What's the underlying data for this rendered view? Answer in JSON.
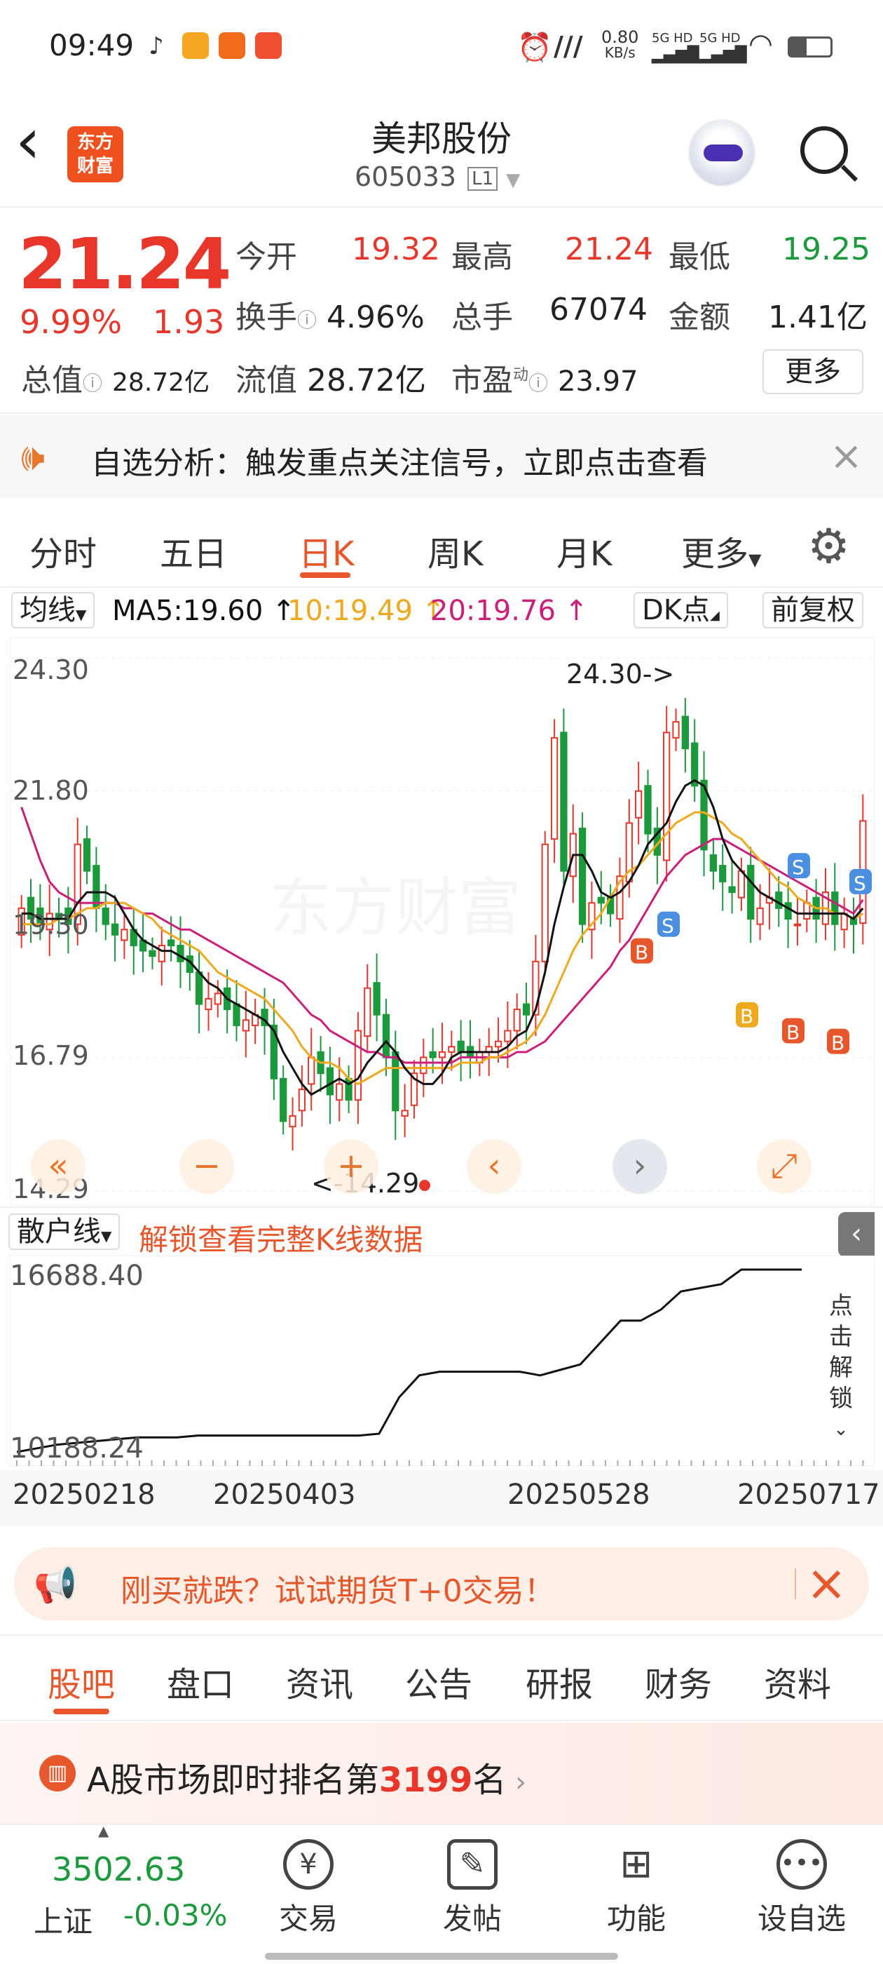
{
  "status_bar": {
    "time": "09:49",
    "net_speed": "0.80",
    "net_unit": "KB/s",
    "sig1": "5G HD",
    "sig2": "5G HD"
  },
  "header": {
    "back": "‹",
    "logo_line1": "东方",
    "logo_line2": "财富",
    "stock_name": "美邦股份",
    "stock_code": "605033",
    "level": "L1"
  },
  "quote": {
    "price": "21.24",
    "change_pct": "9.99%",
    "change": "1.93",
    "fields": [
      {
        "label": "今开",
        "value": "19.32"
      },
      {
        "label": "最高",
        "value": "21.24"
      },
      {
        "label": "最低",
        "value": "19.25"
      },
      {
        "label": "换手",
        "value": "4.96%"
      },
      {
        "label": "总手",
        "value": "67074"
      },
      {
        "label": "金额",
        "value": "1.41亿"
      },
      {
        "label": "总值",
        "value": "28.72亿"
      },
      {
        "label": "流值",
        "value": "28.72亿"
      },
      {
        "label": "市盈",
        "value": "23.97"
      }
    ],
    "pe_sup": "动",
    "more_button": "更多"
  },
  "alert_banner": {
    "text": "自选分析：触发重点关注信号，立即点击查看"
  },
  "chart_tabs": [
    "分时",
    "五日",
    "日K",
    "周K",
    "月K",
    "更多"
  ],
  "active_tab": "日K",
  "ma_bar": {
    "selector": "均线",
    "ma5": "MA5:19.60 ↑",
    "ma10": "10:19.49 ↑",
    "ma20": "20:19.76 ↑",
    "dk": "DK点",
    "fq": "前复权"
  },
  "colors": {
    "ma5": "#111111",
    "ma10": "#f0a81c",
    "ma20": "#cc1f7a",
    "up": "#e8362b",
    "down": "#1a9a3a",
    "accent": "#e8572b"
  },
  "chart_data": {
    "type": "candlestick",
    "y_ticks": [
      "24.30",
      "21.80",
      "16.79",
      "14.29"
    ],
    "ylim": [
      14.29,
      24.3
    ],
    "high_label": "24.30->",
    "low_label": "<-14.29",
    "mid_tick": "19.30",
    "x_ticks": [
      "20250218",
      "20250403",
      "20250528",
      "20250717"
    ],
    "close": [
      19.6,
      19.4,
      19.3,
      19.5,
      19.4,
      19.3,
      20.8,
      20.3,
      19.6,
      19.3,
      19.1,
      19.2,
      18.9,
      18.8,
      18.7,
      18.9,
      18.9,
      18.6,
      18.4,
      17.8,
      17.9,
      18.0,
      17.7,
      17.4,
      17.5,
      17.6,
      17.4,
      16.4,
      15.6,
      15.7,
      16.2,
      16.8,
      16.5,
      16.1,
      16.3,
      16.0,
      17.3,
      18.1,
      17.6,
      16.8,
      15.8,
      15.8,
      16.5,
      16.8,
      16.8,
      16.9,
      17.0,
      16.9,
      16.8,
      16.9,
      17.0,
      17.1,
      17.3,
      17.7,
      17.6,
      18.6,
      20.8,
      22.8,
      20.3,
      21.0,
      19.3,
      19.7,
      19.7,
      19.5,
      20.2,
      21.2,
      21.8,
      21.0,
      20.6,
      22.9,
      23.1,
      22.6,
      21.9,
      20.7,
      20.3,
      20.1,
      19.9,
      20.3,
      19.4,
      19.6,
      19.8,
      19.6,
      19.4,
      19.3,
      19.7,
      19.4,
      19.9,
      19.3,
      19.5,
      19.3,
      21.24
    ],
    "open": [
      19.1,
      19.8,
      19.6,
      19.2,
      19.5,
      19.6,
      19.3,
      20.9,
      20.4,
      19.6,
      19.3,
      19.0,
      19.2,
      19.0,
      18.8,
      18.6,
      19.0,
      18.9,
      18.7,
      18.4,
      17.7,
      17.8,
      18.1,
      17.8,
      17.3,
      17.4,
      17.7,
      17.4,
      16.4,
      15.5,
      15.8,
      16.3,
      16.9,
      16.6,
      16.0,
      16.4,
      16.0,
      17.2,
      18.2,
      17.6,
      16.9,
      15.7,
      15.9,
      16.5,
      16.9,
      16.8,
      16.9,
      17.1,
      17.0,
      16.7,
      16.9,
      17.0,
      17.1,
      17.3,
      17.8,
      17.6,
      18.6,
      20.9,
      22.9,
      20.2,
      21.1,
      19.2,
      19.8,
      19.8,
      19.4,
      20.1,
      21.3,
      21.9,
      21.1,
      20.5,
      22.8,
      23.2,
      22.7,
      22.0,
      20.6,
      20.4,
      20.0,
      19.8,
      20.4,
      19.3,
      19.7,
      19.9,
      19.7,
      19.3,
      19.4,
      19.8,
      19.3,
      19.9,
      19.2,
      19.4,
      19.32
    ],
    "ma5": [
      19.5,
      19.5,
      19.4,
      19.4,
      19.4,
      19.4,
      19.7,
      19.9,
      19.9,
      19.9,
      19.8,
      19.5,
      19.2,
      19.0,
      18.9,
      18.8,
      18.8,
      18.7,
      18.6,
      18.4,
      18.2,
      18.1,
      17.9,
      17.8,
      17.7,
      17.6,
      17.5,
      17.3,
      16.9,
      16.6,
      16.3,
      16.1,
      16.2,
      16.3,
      16.4,
      16.3,
      16.4,
      16.7,
      16.9,
      17.1,
      16.9,
      16.6,
      16.4,
      16.3,
      16.3,
      16.5,
      16.8,
      16.9,
      16.9,
      16.9,
      16.9,
      16.9,
      17.0,
      17.2,
      17.3,
      17.7,
      18.4,
      19.3,
      20.0,
      20.6,
      20.6,
      20.3,
      19.9,
      19.8,
      19.9,
      20.1,
      20.4,
      20.8,
      21.0,
      21.2,
      21.6,
      21.9,
      22.0,
      21.9,
      21.5,
      20.9,
      20.5,
      20.3,
      20.1,
      19.9,
      19.8,
      19.7,
      19.6,
      19.5,
      19.5,
      19.5,
      19.5,
      19.5,
      19.5,
      19.4,
      19.6
    ],
    "ma10": [
      19.3,
      19.3,
      19.3,
      19.3,
      19.4,
      19.4,
      19.5,
      19.6,
      19.6,
      19.7,
      19.7,
      19.7,
      19.6,
      19.5,
      19.4,
      19.2,
      19.1,
      19.0,
      18.9,
      18.8,
      18.6,
      18.4,
      18.3,
      18.2,
      18.1,
      18.0,
      17.9,
      17.7,
      17.5,
      17.3,
      17.0,
      16.8,
      16.7,
      16.7,
      16.6,
      16.4,
      16.3,
      16.4,
      16.5,
      16.6,
      16.6,
      16.6,
      16.6,
      16.6,
      16.6,
      16.6,
      16.6,
      16.7,
      16.7,
      16.7,
      16.8,
      16.8,
      16.9,
      17.0,
      17.1,
      17.3,
      17.6,
      18.0,
      18.4,
      18.8,
      19.1,
      19.3,
      19.5,
      19.8,
      20.1,
      20.3,
      20.4,
      20.6,
      20.8,
      21.0,
      21.2,
      21.3,
      21.4,
      21.4,
      21.3,
      21.2,
      21.0,
      20.9,
      20.7,
      20.5,
      20.3,
      20.1,
      20.0,
      19.8,
      19.7,
      19.6,
      19.6,
      19.5,
      19.5,
      19.4,
      19.5
    ],
    "ma20": [
      21.5,
      21.0,
      20.5,
      20.1,
      19.9,
      19.8,
      19.7,
      19.7,
      19.7,
      19.7,
      19.7,
      19.6,
      19.6,
      19.5,
      19.5,
      19.4,
      19.3,
      19.2,
      19.2,
      19.1,
      19.0,
      18.9,
      18.8,
      18.7,
      18.6,
      18.5,
      18.4,
      18.3,
      18.2,
      18.0,
      17.8,
      17.6,
      17.5,
      17.3,
      17.2,
      17.1,
      17.0,
      16.9,
      16.9,
      16.8,
      16.8,
      16.7,
      16.7,
      16.7,
      16.7,
      16.7,
      16.7,
      16.8,
      16.8,
      16.8,
      16.8,
      16.8,
      16.8,
      16.9,
      16.9,
      17.0,
      17.1,
      17.3,
      17.5,
      17.7,
      17.9,
      18.1,
      18.3,
      18.5,
      18.8,
      19.0,
      19.3,
      19.6,
      19.9,
      20.2,
      20.4,
      20.6,
      20.7,
      20.8,
      20.9,
      20.9,
      20.8,
      20.7,
      20.6,
      20.5,
      20.4,
      20.3,
      20.2,
      20.1,
      20.0,
      19.9,
      19.8,
      19.7,
      19.6,
      19.5,
      19.76
    ]
  },
  "retail": {
    "selector": "散户线",
    "unlock": "解锁查看完整K线数据",
    "top_value": "16688.40",
    "bottom_value": "10188.24",
    "side_unlock": [
      "点",
      "击",
      "解",
      "锁"
    ]
  },
  "futures_banner": {
    "text": "刚买就跌？试试期货T+0交易！"
  },
  "info_tabs": [
    "股吧",
    "盘口",
    "资讯",
    "公告",
    "研报",
    "财务",
    "资料"
  ],
  "rank": {
    "prefix": "A股市场即时排名第",
    "rank": "3199",
    "suffix": "名"
  },
  "bottom_nav": {
    "index_value": "3502.63",
    "index_name": "上证",
    "index_change": "-0.03%",
    "items": [
      "交易",
      "发帖",
      "功能",
      "设自选"
    ]
  }
}
